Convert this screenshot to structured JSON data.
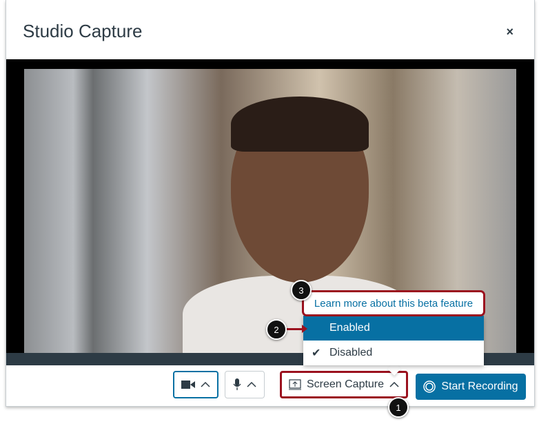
{
  "modal": {
    "title": "Studio Capture",
    "close_icon": "×"
  },
  "controls": {
    "screen_capture_label": "Screen Capture",
    "start_recording_label": "Start Recording"
  },
  "menu": {
    "learn_more": "Learn more about this beta feature",
    "items": [
      {
        "label": "Enabled",
        "highlighted": true,
        "checked": false
      },
      {
        "label": "Disabled",
        "highlighted": false,
        "checked": true
      }
    ]
  },
  "callouts": [
    "1",
    "2",
    "3"
  ],
  "colors": {
    "accent": "#0770a3",
    "callout_border": "#9b111e"
  }
}
